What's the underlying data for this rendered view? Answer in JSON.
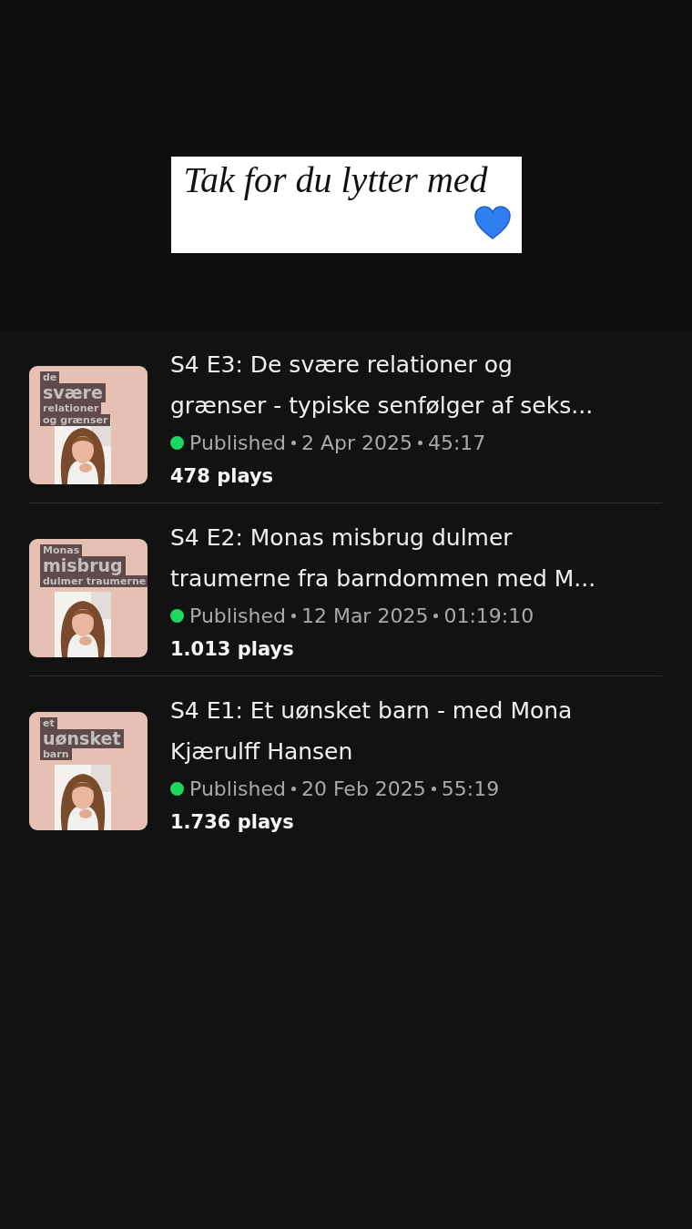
{
  "sticker": {
    "text": "Tak for du lytter med"
  },
  "episodes": [
    {
      "cover_lines": [
        {
          "text": "de",
          "kind": "small"
        },
        {
          "text": "svære",
          "kind": "big"
        },
        {
          "text": "relationer",
          "kind": "small"
        },
        {
          "text": "og grænser",
          "kind": "small"
        }
      ],
      "title_lines": [
        "S4 E3: De svære relationer og",
        "grænser - typiske senfølger af seks..."
      ],
      "status": "Published",
      "color": "#1ed760",
      "date": "2 Apr 2025",
      "duration": "45:17",
      "plays": "478 plays"
    },
    {
      "cover_lines": [
        {
          "text": "Monas",
          "kind": "small"
        },
        {
          "text": "misbrug",
          "kind": "big"
        },
        {
          "text": "dulmer traumerne",
          "kind": "small"
        }
      ],
      "title_lines": [
        "S4 E2: Monas misbrug dulmer",
        "traumerne fra barndommen med M..."
      ],
      "status": "Published",
      "color": "#1ed760",
      "date": "12 Mar 2025",
      "duration": "01:19:10",
      "plays": "1.013 plays"
    },
    {
      "cover_lines": [
        {
          "text": "et",
          "kind": "small"
        },
        {
          "text": "uønsket",
          "kind": "big"
        },
        {
          "text": "barn",
          "kind": "small"
        }
      ],
      "title_lines": [
        "S4 E1: Et uønsket barn - med Mona",
        "Kjærulff Hansen"
      ],
      "status": "Published",
      "color": "#1ed760",
      "date": "20 Feb 2025",
      "duration": "55:19",
      "plays": "1.736 plays"
    }
  ]
}
